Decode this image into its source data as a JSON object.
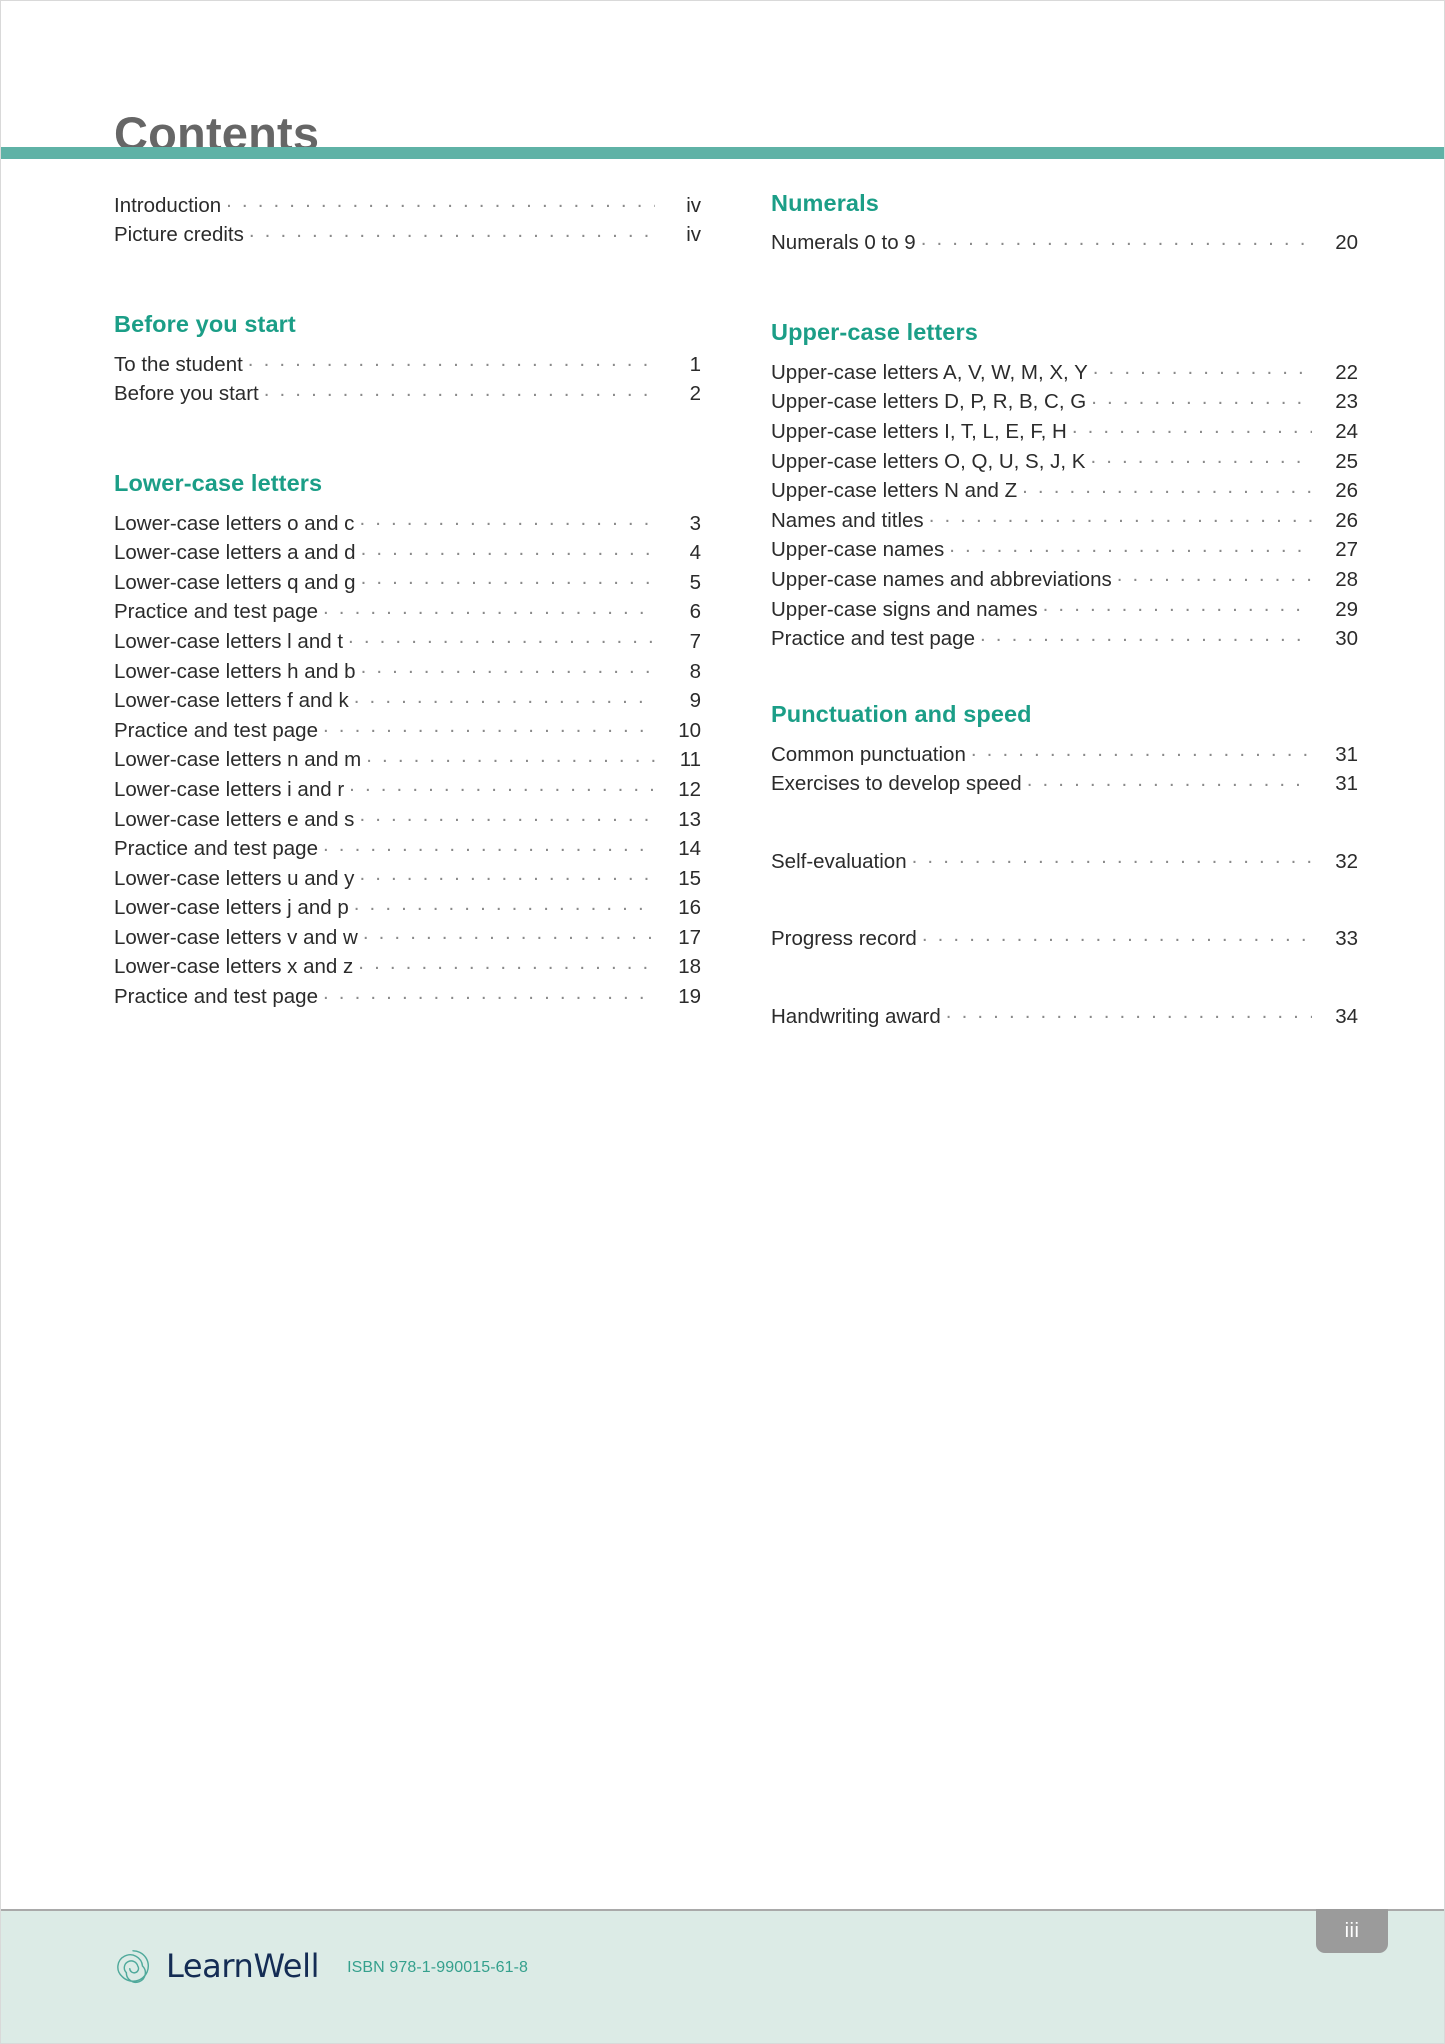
{
  "document": {
    "title": "Contents",
    "folio": "iii"
  },
  "theme": {
    "rule_color": "#5fb2a6",
    "heading_color": "#1b9e87",
    "title_color": "#666666",
    "body_color": "#2b2b2b",
    "leader_color": "#8a8a8a",
    "footer_bg": "#dcebe6",
    "brand_navy": "#142c54",
    "brand_teal": "#35a08d",
    "folio_bg": "#9b9b9b"
  },
  "columns": [
    {
      "name": "left-column",
      "sections": [
        {
          "heading": null,
          "spacing": "none",
          "entries": [
            {
              "label": "Introduction",
              "page": "iv"
            },
            {
              "label": "Picture credits",
              "page": "iv"
            }
          ]
        },
        {
          "heading": "Before you start",
          "spacing": "large",
          "entries": [
            {
              "label": "To the student",
              "page": "1"
            },
            {
              "label": "Before you start",
              "page": "2"
            }
          ]
        },
        {
          "heading": "Lower-case letters",
          "spacing": "large",
          "entries": [
            {
              "label": "Lower-case letters o and c",
              "page": "3"
            },
            {
              "label": "Lower-case letters a and d",
              "page": "4"
            },
            {
              "label": "Lower-case letters q and g",
              "page": "5"
            },
            {
              "label": "Practice and test page",
              "page": "6"
            },
            {
              "label": "Lower-case letters l and t",
              "page": "7"
            },
            {
              "label": "Lower-case letters h and b",
              "page": "8"
            },
            {
              "label": "Lower-case letters f and k",
              "page": "9"
            },
            {
              "label": "Practice and test page",
              "page": "10"
            },
            {
              "label": "Lower-case letters n and m",
              "page": "11"
            },
            {
              "label": "Lower-case letters i and r",
              "page": "12"
            },
            {
              "label": "Lower-case letters e and s",
              "page": "13"
            },
            {
              "label": "Practice and test page",
              "page": "14"
            },
            {
              "label": "Lower-case letters u and y",
              "page": "15"
            },
            {
              "label": "Lower-case letters j and p",
              "page": "16"
            },
            {
              "label": "Lower-case letters v and w",
              "page": "17"
            },
            {
              "label": "Lower-case letters x and z",
              "page": "18"
            },
            {
              "label": "Practice and test page",
              "page": "19"
            }
          ]
        }
      ]
    },
    {
      "name": "right-column",
      "sections": [
        {
          "heading": "Numerals",
          "spacing": "none",
          "entries": [
            {
              "label": "Numerals 0 to 9",
              "page": "20"
            }
          ]
        },
        {
          "heading": "Upper-case letters",
          "spacing": "large",
          "entries": [
            {
              "label": "Upper-case letters A, V, W, M, X, Y",
              "page": "22"
            },
            {
              "label": "Upper-case letters D, P, R, B, C, G",
              "page": "23"
            },
            {
              "label": "Upper-case letters I, T, L, E, F, H",
              "page": "24"
            },
            {
              "label": "Upper-case letters O, Q, U, S, J, K",
              "page": "25"
            },
            {
              "label": "Upper-case letters N and Z",
              "page": "26"
            },
            {
              "label": "Names and titles",
              "page": "26"
            },
            {
              "label": "Upper-case names",
              "page": "27"
            },
            {
              "label": "Upper-case names and abbreviations",
              "page": "28"
            },
            {
              "label": "Upper-case signs and names",
              "page": "29"
            },
            {
              "label": "Practice and test page",
              "page": "30"
            }
          ]
        },
        {
          "heading": "Punctuation and speed",
          "spacing": "medium",
          "entries": [
            {
              "label": "Common punctuation",
              "page": "31"
            },
            {
              "label": "Exercises to develop speed",
              "page": "31"
            }
          ]
        },
        {
          "heading": null,
          "spacing": "medium",
          "entries": [
            {
              "label": "Self-evaluation",
              "page": "32"
            }
          ]
        },
        {
          "heading": null,
          "spacing": "medium",
          "entries": [
            {
              "label": "Progress record",
              "page": "33"
            }
          ]
        },
        {
          "heading": null,
          "spacing": "medium",
          "entries": [
            {
              "label": "Handwriting award",
              "page": "34"
            }
          ]
        }
      ]
    }
  ],
  "footer": {
    "brand_name": "LearnWell",
    "brand_mark": "spiral-logo-icon",
    "isbn": "ISBN 978-1-990015-61-8"
  }
}
